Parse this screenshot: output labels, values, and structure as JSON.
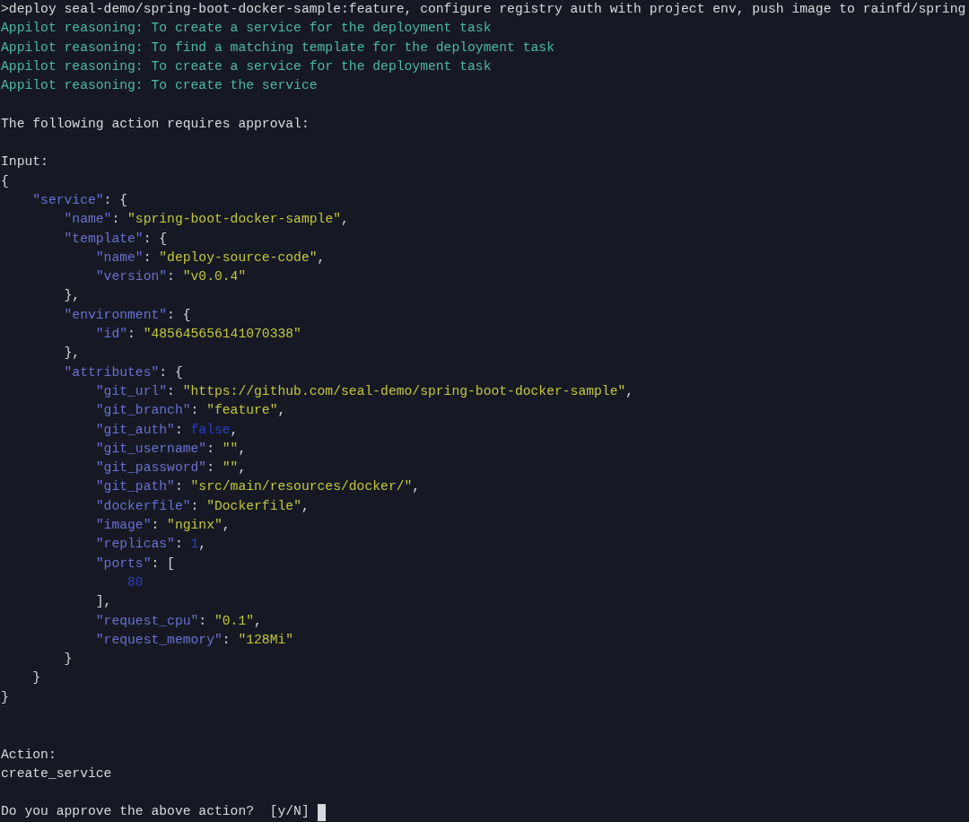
{
  "terminal": {
    "lines": [
      {
        "kind": "text",
        "tokens": [
          {
            "kind": "plain",
            "text": ">deploy seal-demo/spring-boot-docker-sample:feature, configure registry auth with project env, push image to rainfd/spring"
          }
        ]
      },
      {
        "kind": "text",
        "tokens": [
          {
            "kind": "reasoning",
            "text": "Appilot reasoning: To create a service for the deployment task"
          }
        ]
      },
      {
        "kind": "text",
        "tokens": [
          {
            "kind": "reasoning",
            "text": "Appilot reasoning: To find a matching template for the deployment task"
          }
        ]
      },
      {
        "kind": "text",
        "tokens": [
          {
            "kind": "reasoning",
            "text": "Appilot reasoning: To create a service for the deployment task"
          }
        ]
      },
      {
        "kind": "text",
        "tokens": [
          {
            "kind": "reasoning",
            "text": "Appilot reasoning: To create the service"
          }
        ]
      },
      {
        "kind": "blank"
      },
      {
        "kind": "text",
        "tokens": [
          {
            "kind": "plain",
            "text": "The following action requires approval:"
          }
        ]
      },
      {
        "kind": "blank"
      },
      {
        "kind": "text",
        "tokens": [
          {
            "kind": "plain",
            "text": "Input:"
          }
        ]
      },
      {
        "kind": "text",
        "tokens": [
          {
            "kind": "plain",
            "text": "{"
          }
        ],
        "close": "}",
        "children": [
          {
            "kind": "text",
            "tokens": [
              {
                "kind": "key",
                "text": "\"service\""
              },
              {
                "kind": "plain",
                "text": ": {"
              }
            ],
            "close": "}",
            "children": [
              {
                "kind": "text",
                "tokens": [
                  {
                    "kind": "key",
                    "text": "\"name\""
                  },
                  {
                    "kind": "plain",
                    "text": ": "
                  },
                  {
                    "kind": "string",
                    "text": "\"spring-boot-docker-sample\""
                  },
                  {
                    "kind": "plain",
                    "text": ","
                  }
                ]
              },
              {
                "kind": "text",
                "tokens": [
                  {
                    "kind": "key",
                    "text": "\"template\""
                  },
                  {
                    "kind": "plain",
                    "text": ": {"
                  }
                ],
                "close": "},",
                "children": [
                  {
                    "kind": "text",
                    "tokens": [
                      {
                        "kind": "key",
                        "text": "\"name\""
                      },
                      {
                        "kind": "plain",
                        "text": ": "
                      },
                      {
                        "kind": "string",
                        "text": "\"deploy-source-code\""
                      },
                      {
                        "kind": "plain",
                        "text": ","
                      }
                    ]
                  },
                  {
                    "kind": "text",
                    "tokens": [
                      {
                        "kind": "key",
                        "text": "\"version\""
                      },
                      {
                        "kind": "plain",
                        "text": ": "
                      },
                      {
                        "kind": "string",
                        "text": "\"v0.0.4\""
                      }
                    ]
                  }
                ]
              },
              {
                "kind": "text",
                "tokens": [
                  {
                    "kind": "key",
                    "text": "\"environment\""
                  },
                  {
                    "kind": "plain",
                    "text": ": {"
                  }
                ],
                "close": "},",
                "children": [
                  {
                    "kind": "text",
                    "tokens": [
                      {
                        "kind": "key",
                        "text": "\"id\""
                      },
                      {
                        "kind": "plain",
                        "text": ": "
                      },
                      {
                        "kind": "string",
                        "text": "\"485645656141070338\""
                      }
                    ]
                  }
                ]
              },
              {
                "kind": "text",
                "tokens": [
                  {
                    "kind": "key",
                    "text": "\"attributes\""
                  },
                  {
                    "kind": "plain",
                    "text": ": {"
                  }
                ],
                "close": "}",
                "children": [
                  {
                    "kind": "text",
                    "tokens": [
                      {
                        "kind": "key",
                        "text": "\"git_url\""
                      },
                      {
                        "kind": "plain",
                        "text": ": "
                      },
                      {
                        "kind": "string",
                        "text": "\"https://github.com/seal-demo/spring-boot-docker-sample\""
                      },
                      {
                        "kind": "plain",
                        "text": ","
                      }
                    ]
                  },
                  {
                    "kind": "text",
                    "tokens": [
                      {
                        "kind": "key",
                        "text": "\"git_branch\""
                      },
                      {
                        "kind": "plain",
                        "text": ": "
                      },
                      {
                        "kind": "string",
                        "text": "\"feature\""
                      },
                      {
                        "kind": "plain",
                        "text": ","
                      }
                    ]
                  },
                  {
                    "kind": "text",
                    "tokens": [
                      {
                        "kind": "key",
                        "text": "\"git_auth\""
                      },
                      {
                        "kind": "plain",
                        "text": ": "
                      },
                      {
                        "kind": "literal",
                        "text": "false"
                      },
                      {
                        "kind": "plain",
                        "text": ","
                      }
                    ]
                  },
                  {
                    "kind": "text",
                    "tokens": [
                      {
                        "kind": "key",
                        "text": "\"git_username\""
                      },
                      {
                        "kind": "plain",
                        "text": ": "
                      },
                      {
                        "kind": "string",
                        "text": "\"\""
                      },
                      {
                        "kind": "plain",
                        "text": ","
                      }
                    ]
                  },
                  {
                    "kind": "text",
                    "tokens": [
                      {
                        "kind": "key",
                        "text": "\"git_password\""
                      },
                      {
                        "kind": "plain",
                        "text": ": "
                      },
                      {
                        "kind": "string",
                        "text": "\"\""
                      },
                      {
                        "kind": "plain",
                        "text": ","
                      }
                    ]
                  },
                  {
                    "kind": "text",
                    "tokens": [
                      {
                        "kind": "key",
                        "text": "\"git_path\""
                      },
                      {
                        "kind": "plain",
                        "text": ": "
                      },
                      {
                        "kind": "string",
                        "text": "\"src/main/resources/docker/\""
                      },
                      {
                        "kind": "plain",
                        "text": ","
                      }
                    ]
                  },
                  {
                    "kind": "text",
                    "tokens": [
                      {
                        "kind": "key",
                        "text": "\"dockerfile\""
                      },
                      {
                        "kind": "plain",
                        "text": ": "
                      },
                      {
                        "kind": "string",
                        "text": "\"Dockerfile\""
                      },
                      {
                        "kind": "plain",
                        "text": ","
                      }
                    ]
                  },
                  {
                    "kind": "text",
                    "tokens": [
                      {
                        "kind": "key",
                        "text": "\"image\""
                      },
                      {
                        "kind": "plain",
                        "text": ": "
                      },
                      {
                        "kind": "string",
                        "text": "\"nginx\""
                      },
                      {
                        "kind": "plain",
                        "text": ","
                      }
                    ]
                  },
                  {
                    "kind": "text",
                    "tokens": [
                      {
                        "kind": "key",
                        "text": "\"replicas\""
                      },
                      {
                        "kind": "plain",
                        "text": ": "
                      },
                      {
                        "kind": "literal",
                        "text": "1"
                      },
                      {
                        "kind": "plain",
                        "text": ","
                      }
                    ]
                  },
                  {
                    "kind": "text",
                    "tokens": [
                      {
                        "kind": "key",
                        "text": "\"ports\""
                      },
                      {
                        "kind": "plain",
                        "text": ": ["
                      }
                    ],
                    "close": "],",
                    "children": [
                      {
                        "kind": "text",
                        "tokens": [
                          {
                            "kind": "literal",
                            "text": "80"
                          }
                        ]
                      }
                    ]
                  },
                  {
                    "kind": "text",
                    "tokens": [
                      {
                        "kind": "key",
                        "text": "\"request_cpu\""
                      },
                      {
                        "kind": "plain",
                        "text": ": "
                      },
                      {
                        "kind": "string",
                        "text": "\"0.1\""
                      },
                      {
                        "kind": "plain",
                        "text": ","
                      }
                    ]
                  },
                  {
                    "kind": "text",
                    "tokens": [
                      {
                        "kind": "key",
                        "text": "\"request_memory\""
                      },
                      {
                        "kind": "plain",
                        "text": ": "
                      },
                      {
                        "kind": "string",
                        "text": "\"128Mi\""
                      }
                    ]
                  }
                ]
              }
            ]
          }
        ]
      },
      {
        "kind": "blank"
      },
      {
        "kind": "blank"
      },
      {
        "kind": "text",
        "tokens": [
          {
            "kind": "plain",
            "text": "Action:"
          }
        ]
      },
      {
        "kind": "text",
        "tokens": [
          {
            "kind": "plain",
            "text": "create_service"
          }
        ]
      },
      {
        "kind": "blank"
      },
      {
        "kind": "prompt",
        "tokens": [
          {
            "kind": "plain",
            "text": "Do you approve the above action?  [y/N] "
          }
        ]
      }
    ]
  }
}
